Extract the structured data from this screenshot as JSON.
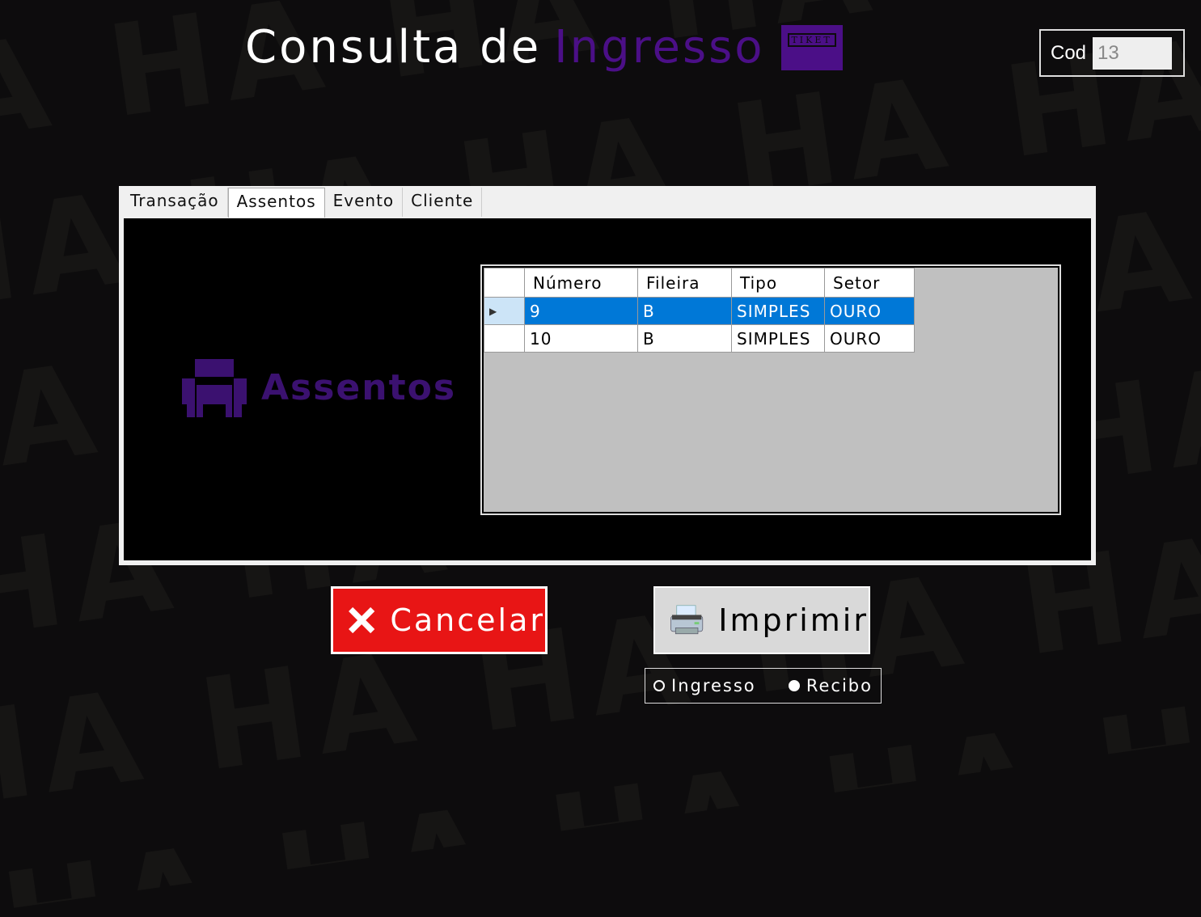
{
  "header": {
    "title_part1": "Consulta de",
    "title_part2": "Ingresso",
    "logo_text": "TIKET"
  },
  "cod": {
    "label": "Cod",
    "value": "13"
  },
  "tabs": [
    {
      "label": "Transação"
    },
    {
      "label": "Assentos",
      "active": true
    },
    {
      "label": "Evento"
    },
    {
      "label": "Cliente"
    }
  ],
  "seats_label": "Assentos",
  "table": {
    "columns": [
      "Número",
      "Fileira",
      "Tipo",
      "Setor"
    ],
    "rows": [
      [
        "9",
        "B",
        "SIMPLES",
        "OURO"
      ],
      [
        "10",
        "B",
        "SIMPLES",
        "OURO"
      ]
    ],
    "selected_row": 0
  },
  "buttons": {
    "cancel": "Cancelar",
    "print": "Imprimir"
  },
  "print_options": [
    {
      "label": "Ingresso",
      "checked": false
    },
    {
      "label": "Recibo",
      "checked": true
    }
  ],
  "colors": {
    "accent": "#4b0f87",
    "cancel": "#e81515",
    "selection": "#0078d7"
  }
}
